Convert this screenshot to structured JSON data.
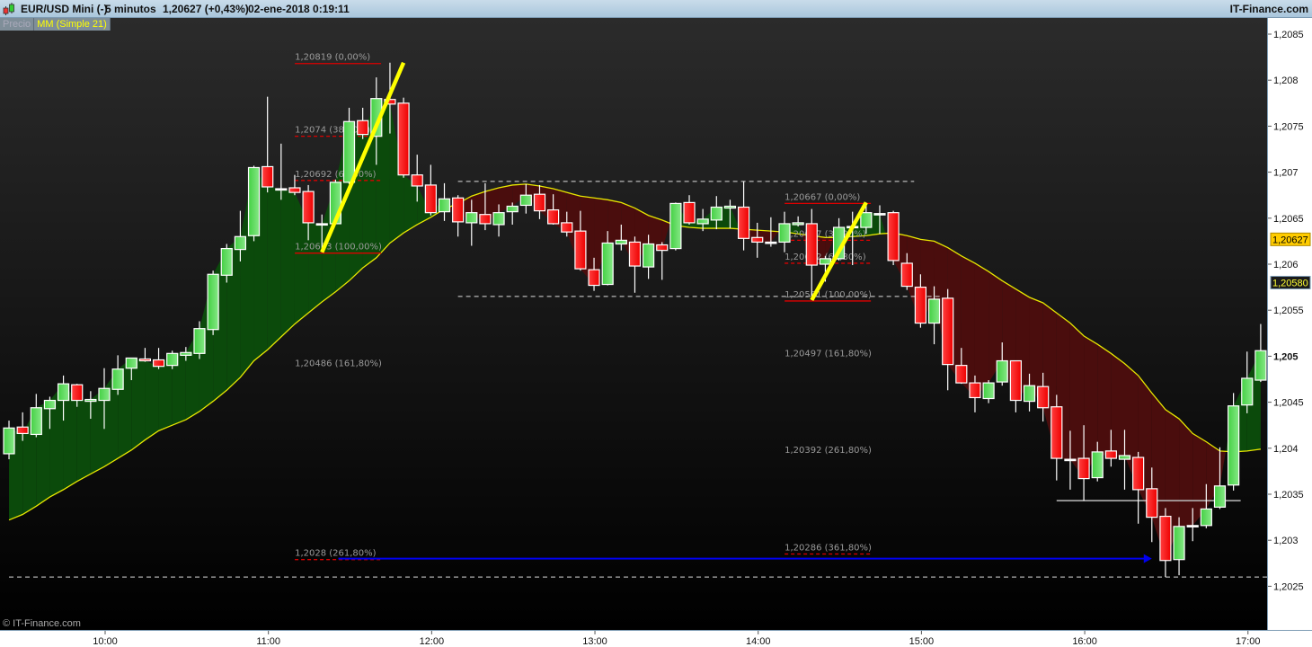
{
  "header": {
    "instrument": "EUR/USD Mini (-)",
    "interval": "5 minutos",
    "price": "1,20627 (+0,43%)",
    "datetime": "02-ene-2018 0:19:11",
    "brand": "IT-Finance.com",
    "logo_icon": "candlestick-icon"
  },
  "legend": {
    "price_label": "Precio",
    "ma_label": "MM (Simple 21)"
  },
  "copyright": "© IT-Finance.com",
  "colors": {
    "up": "#5ad85a",
    "down": "#ff1a1a",
    "ma": "#e8e800",
    "fill_up": "#0b4a0b",
    "fill_down": "#4a0d0d",
    "trendline": "#ffff00",
    "fib": "#dd0000",
    "arrow": "#0000ee"
  },
  "chart_data": {
    "type": "candlestick",
    "title": "",
    "ylim": [
      1.2021,
      1.2088
    ],
    "y_ticks": [
      {
        "value": 1.2085,
        "label": "1,2085"
      },
      {
        "value": 1.208,
        "label": "1,208"
      },
      {
        "value": 1.2075,
        "label": "1,2075"
      },
      {
        "value": 1.207,
        "label": "1,207"
      },
      {
        "value": 1.2065,
        "label": "1,2065"
      },
      {
        "value": 1.206,
        "label": "1,206"
      },
      {
        "value": 1.2055,
        "label": "1,2055"
      },
      {
        "value": 1.205,
        "label": "1,205",
        "bold": true
      },
      {
        "value": 1.2045,
        "label": "1,2045"
      },
      {
        "value": 1.204,
        "label": "1,204"
      },
      {
        "value": 1.2035,
        "label": "1,2035"
      },
      {
        "value": 1.203,
        "label": "1,203"
      },
      {
        "value": 1.2025,
        "label": "1,2025"
      }
    ],
    "x_ticks": [
      "10:00",
      "11:00",
      "12:00",
      "13:00",
      "14:00",
      "15:00",
      "16:00",
      "17:00"
    ],
    "price_markers": [
      {
        "value": 1.20627,
        "label": "1,20627",
        "style": "yellow"
      },
      {
        "value": 1.2058,
        "label": "1,20580",
        "style": "dark"
      }
    ],
    "candles": [
      [
        "09:25",
        1.20394,
        1.2043,
        1.20388,
        1.20422
      ],
      [
        "09:30",
        1.20423,
        1.20439,
        1.20408,
        1.20416
      ],
      [
        "09:35",
        1.20415,
        1.20459,
        1.20412,
        1.20444
      ],
      [
        "09:40",
        1.20443,
        1.20456,
        1.20421,
        1.20452
      ],
      [
        "09:45",
        1.20452,
        1.20479,
        1.2043,
        1.2047
      ],
      [
        "09:50",
        1.20469,
        1.2047,
        1.20445,
        1.20452
      ],
      [
        "09:55",
        1.20451,
        1.20462,
        1.20432,
        1.20453
      ],
      [
        "10:00",
        1.20452,
        1.20487,
        1.20421,
        1.20465
      ],
      [
        "10:05",
        1.20464,
        1.20501,
        1.20458,
        1.20486
      ],
      [
        "10:10",
        1.20487,
        1.20498,
        1.20474,
        1.20498
      ],
      [
        "10:15",
        1.20497,
        1.20509,
        1.20494,
        1.20495
      ],
      [
        "10:20",
        1.20496,
        1.20509,
        1.20486,
        1.20489
      ],
      [
        "10:25",
        1.2049,
        1.20506,
        1.20486,
        1.20503
      ],
      [
        "10:30",
        1.20501,
        1.2051,
        1.20495,
        1.20504
      ],
      [
        "10:35",
        1.20503,
        1.20538,
        1.20497,
        1.2053
      ],
      [
        "10:40",
        1.20529,
        1.20593,
        1.20523,
        1.20589
      ],
      [
        "10:45",
        1.20588,
        1.20622,
        1.2058,
        1.20617
      ],
      [
        "10:50",
        1.20616,
        1.20658,
        1.20603,
        1.2063
      ],
      [
        "10:55",
        1.20631,
        1.20707,
        1.20625,
        1.20705
      ],
      [
        "11:00",
        1.20706,
        1.20782,
        1.20678,
        1.20684
      ],
      [
        "11:05",
        1.20682,
        1.20731,
        1.2067,
        1.20682
      ],
      [
        "11:10",
        1.20683,
        1.20697,
        1.20675,
        1.20678
      ],
      [
        "11:15",
        1.20679,
        1.20686,
        1.20626,
        1.20645
      ],
      [
        "11:20",
        1.20644,
        1.20654,
        1.20613,
        1.20643
      ],
      [
        "11:25",
        1.20644,
        1.20692,
        1.20643,
        1.20689
      ],
      [
        "11:30",
        1.20689,
        1.2077,
        1.20687,
        1.20755
      ],
      [
        "11:35",
        1.20756,
        1.2077,
        1.20736,
        1.20741
      ],
      [
        "11:40",
        1.20739,
        1.20803,
        1.20708,
        1.2078
      ],
      [
        "11:45",
        1.20779,
        1.20819,
        1.20742,
        1.20774
      ],
      [
        "11:50",
        1.20775,
        1.20781,
        1.20694,
        1.20697
      ],
      [
        "11:55",
        1.20697,
        1.20719,
        1.20668,
        1.20685
      ],
      [
        "12:00",
        1.20686,
        1.20708,
        1.20653,
        1.20656
      ],
      [
        "12:05",
        1.20657,
        1.20688,
        1.20647,
        1.20671
      ],
      [
        "12:10",
        1.20672,
        1.20675,
        1.2063,
        1.20646
      ],
      [
        "12:15",
        1.20645,
        1.2067,
        1.2062,
        1.20656
      ],
      [
        "12:20",
        1.20654,
        1.20688,
        1.20637,
        1.20644
      ],
      [
        "12:25",
        1.20643,
        1.20665,
        1.2063,
        1.20656
      ],
      [
        "12:30",
        1.20657,
        1.20667,
        1.20643,
        1.20663
      ],
      [
        "12:35",
        1.20664,
        1.20687,
        1.20655,
        1.20675
      ],
      [
        "12:40",
        1.20676,
        1.20686,
        1.20649,
        1.20658
      ],
      [
        "12:45",
        1.20659,
        1.20676,
        1.20643,
        1.20644
      ],
      [
        "12:50",
        1.20645,
        1.20657,
        1.2063,
        1.20635
      ],
      [
        "12:55",
        1.20636,
        1.20658,
        1.20593,
        1.20595
      ],
      [
        "13:00",
        1.20594,
        1.20607,
        1.20571,
        1.20577
      ],
      [
        "13:05",
        1.20578,
        1.20636,
        1.20577,
        1.20623
      ],
      [
        "13:10",
        1.20622,
        1.20643,
        1.20615,
        1.20626
      ],
      [
        "13:15",
        1.20624,
        1.2063,
        1.20569,
        1.20598
      ],
      [
        "13:20",
        1.20597,
        1.20632,
        1.20584,
        1.20622
      ],
      [
        "13:25",
        1.20621,
        1.20624,
        1.20583,
        1.20615
      ],
      [
        "13:30",
        1.20617,
        1.20667,
        1.20615,
        1.20666
      ],
      [
        "13:35",
        1.20667,
        1.20675,
        1.20643,
        1.20645
      ],
      [
        "13:40",
        1.20644,
        1.2066,
        1.20636,
        1.20649
      ],
      [
        "13:45",
        1.20648,
        1.20674,
        1.20638,
        1.20662
      ],
      [
        "13:50",
        1.20661,
        1.2067,
        1.20639,
        1.20663
      ],
      [
        "13:55",
        1.20662,
        1.2069,
        1.20615,
        1.20628
      ],
      [
        "14:00",
        1.20629,
        1.20645,
        1.20607,
        1.20624
      ],
      [
        "14:05",
        1.20623,
        1.20651,
        1.20619,
        1.20624
      ],
      [
        "14:10",
        1.20624,
        1.20657,
        1.20613,
        1.20644
      ],
      [
        "14:15",
        1.20643,
        1.20652,
        1.20641,
        1.20645
      ],
      [
        "14:20",
        1.20644,
        1.2066,
        1.20561,
        1.20599
      ],
      [
        "14:25",
        1.206,
        1.20609,
        1.20581,
        1.20606
      ],
      [
        "14:30",
        1.20606,
        1.2065,
        1.20604,
        1.2064
      ],
      [
        "14:35",
        1.20641,
        1.20657,
        1.20599,
        1.20641
      ],
      [
        "14:40",
        1.2064,
        1.20667,
        1.20633,
        1.20656
      ],
      [
        "14:45",
        1.20655,
        1.20664,
        1.20633,
        1.20655
      ],
      [
        "14:50",
        1.20656,
        1.20658,
        1.20599,
        1.20604
      ],
      [
        "14:55",
        1.20601,
        1.20612,
        1.20572,
        1.20576
      ],
      [
        "15:00",
        1.20575,
        1.20589,
        1.20531,
        1.20536
      ],
      [
        "15:05",
        1.20536,
        1.20576,
        1.20513,
        1.20562
      ],
      [
        "15:10",
        1.20563,
        1.20573,
        1.20463,
        1.20491
      ],
      [
        "15:15",
        1.2049,
        1.20509,
        1.2047,
        1.20471
      ],
      [
        "15:20",
        1.20471,
        1.20479,
        1.20439,
        1.20455
      ],
      [
        "15:25",
        1.20454,
        1.20474,
        1.20449,
        1.20471
      ],
      [
        "15:30",
        1.20472,
        1.20515,
        1.20468,
        1.20495
      ],
      [
        "15:35",
        1.20495,
        1.20495,
        1.20439,
        1.20452
      ],
      [
        "15:40",
        1.20451,
        1.20481,
        1.2044,
        1.20468
      ],
      [
        "15:45",
        1.20467,
        1.20482,
        1.20429,
        1.20444
      ],
      [
        "15:50",
        1.20445,
        1.20458,
        1.20365,
        1.20389
      ],
      [
        "15:55",
        1.20388,
        1.20419,
        1.20355,
        1.20388
      ],
      [
        "16:00",
        1.20389,
        1.20425,
        1.20343,
        1.20367
      ],
      [
        "16:05",
        1.20368,
        1.20407,
        1.20364,
        1.20396
      ],
      [
        "16:10",
        1.20397,
        1.2042,
        1.2038,
        1.20389
      ],
      [
        "16:15",
        1.20388,
        1.2042,
        1.20355,
        1.20392
      ],
      [
        "16:20",
        1.2039,
        1.20396,
        1.20318,
        1.20355
      ],
      [
        "16:25",
        1.20356,
        1.20379,
        1.20298,
        1.20325
      ],
      [
        "16:30",
        1.20326,
        1.20335,
        1.2026,
        1.20278
      ],
      [
        "16:35",
        1.20279,
        1.20325,
        1.20262,
        1.20315
      ],
      [
        "16:40",
        1.20316,
        1.20335,
        1.20299,
        1.20316
      ],
      [
        "16:45",
        1.20316,
        1.20361,
        1.20313,
        1.20334
      ],
      [
        "16:50",
        1.20336,
        1.20401,
        1.20334,
        1.20359
      ],
      [
        "16:55",
        1.2036,
        1.2046,
        1.20354,
        1.20446
      ],
      [
        "17:00",
        1.20447,
        1.20505,
        1.20438,
        1.20476
      ],
      [
        "17:05",
        1.20474,
        1.20535,
        1.20472,
        1.20506
      ]
    ],
    "ma21": [
      1.20322,
      1.20328,
      1.20337,
      1.20347,
      1.20355,
      1.20364,
      1.20372,
      1.2038,
      1.20389,
      1.20398,
      1.20409,
      1.20419,
      1.20425,
      1.20431,
      1.2044,
      1.20451,
      1.20463,
      1.20477,
      1.20495,
      1.20507,
      1.20521,
      1.20535,
      1.20547,
      1.20559,
      1.2057,
      1.20582,
      1.20596,
      1.20607,
      1.20623,
      1.20634,
      1.20643,
      1.20651,
      1.2066,
      1.20666,
      1.20674,
      1.20679,
      1.20683,
      1.20686,
      1.20687,
      1.20685,
      1.20682,
      1.20678,
      1.20674,
      1.20672,
      1.2067,
      1.20667,
      1.20661,
      1.20653,
      1.20648,
      1.20642,
      1.2064,
      1.20639,
      1.20639,
      1.20639,
      1.20638,
      1.20637,
      1.20636,
      1.20635,
      1.20633,
      1.20631,
      1.20629,
      1.20629,
      1.2063,
      1.20631,
      1.20633,
      1.20634,
      1.20631,
      1.20627,
      1.20625,
      1.20618,
      1.20609,
      1.20601,
      1.20592,
      1.20582,
      1.20573,
      1.20564,
      1.20558,
      1.20547,
      1.20536,
      1.20522,
      1.20513,
      1.20503,
      1.20492,
      1.20479,
      1.2046,
      1.20442,
      1.20432,
      1.20416,
      1.20407,
      1.20397,
      1.20396,
      1.20397,
      1.20399
    ],
    "fibonacci": [
      {
        "from": "11:15",
        "to": "11:50",
        "levels": [
          {
            "value": 1.20819,
            "label": "1,20819 (0,00%)",
            "line": "solid"
          },
          {
            "value": 1.2074,
            "label": "1,2074 (38,20%)",
            "line": "dashed"
          },
          {
            "value": 1.20692,
            "label": "1,20692 (61,80%)",
            "line": "dashed"
          },
          {
            "value": 1.20613,
            "label": "1,20613 (100,00%)",
            "line": "solid"
          },
          {
            "value": 1.20486,
            "label": "1,20486 (161,80%)",
            "line": "none"
          },
          {
            "value": 1.2028,
            "label": "1,2028 (261,80%)",
            "line": "dashed"
          }
        ]
      },
      {
        "from": "14:15",
        "to": "14:50",
        "levels": [
          {
            "value": 1.20667,
            "label": "1,20667 (0,00%)",
            "line": "solid"
          },
          {
            "value": 1.20627,
            "label": "1,20627 (38,20%)",
            "line": "dashed"
          },
          {
            "value": 1.20602,
            "label": "1,20602 (61,80%)",
            "line": "dashed"
          },
          {
            "value": 1.20561,
            "label": "1,20561 (100,00%)",
            "line": "solid"
          },
          {
            "value": 1.20497,
            "label": "1,20497 (161,80%)",
            "line": "none"
          },
          {
            "value": 1.20392,
            "label": "1,20392 (261,80%)",
            "line": "none"
          },
          {
            "value": 1.20286,
            "label": "1,20286 (361,80%)",
            "line": "dashed"
          }
        ]
      }
    ],
    "trendlines": [
      {
        "from": [
          "11:20",
          1.20613
        ],
        "to": [
          "11:50",
          1.20819
        ]
      },
      {
        "from": [
          "14:20",
          1.20561
        ],
        "to": [
          "14:40",
          1.20667
        ]
      }
    ],
    "horizontal_lines": [
      {
        "value": 1.2069,
        "from": "12:10",
        "to": "14:55",
        "style": "dashed-white"
      },
      {
        "value": 1.20565,
        "from": "12:10",
        "to": "15:05",
        "style": "dashed-white"
      },
      {
        "value": 1.2026,
        "from": "09:25",
        "to": "17:05",
        "style": "dashed-white"
      },
      {
        "value": 1.20343,
        "from": "15:50",
        "to": "16:55",
        "style": "solid-grey"
      }
    ],
    "arrows": [
      {
        "value": 1.2028,
        "from": "11:30",
        "to": "16:25"
      }
    ]
  }
}
